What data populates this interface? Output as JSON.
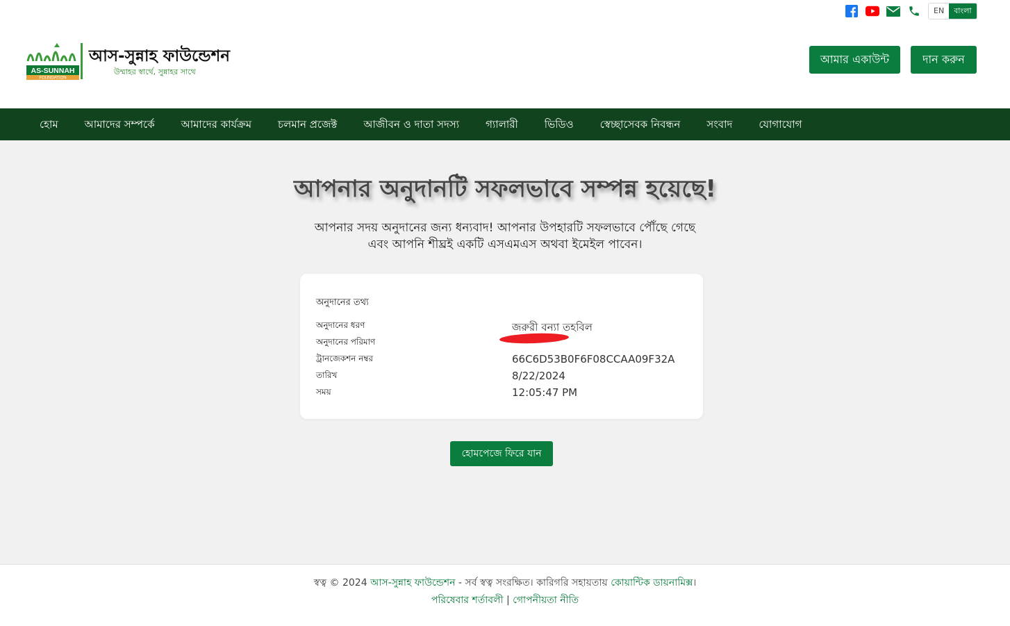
{
  "header": {
    "language": {
      "en": "EN",
      "bn": "বাংলা"
    },
    "brand_name": "আস-সুন্নাহ ফাউন্ডেশন",
    "brand_tagline": "উম্মাহর স্বার্থে, সুন্নাহর সাথে",
    "logo_text": "AS-SUNNAH",
    "logo_subtext": "FOUNDATION",
    "account_button": "আমার একাউন্ট",
    "donate_button": "দান করুন",
    "icons": [
      "facebook-icon",
      "youtube-icon",
      "mail-icon",
      "phone-icon"
    ],
    "colors": {
      "facebook": "#1877f2",
      "youtube": "#ff0000",
      "accent": "#0b7d3e"
    }
  },
  "nav": {
    "items": [
      {
        "label": "হোম"
      },
      {
        "label": "আমাদের সম্পর্কে"
      },
      {
        "label": "আমাদের কার্যক্রম"
      },
      {
        "label": "চলমান প্রজেক্ট"
      },
      {
        "label": "আজীবন ও দাতা সদস্য"
      },
      {
        "label": "গ্যালারী"
      },
      {
        "label": "ভিডিও"
      },
      {
        "label": "স্বেচ্ছাসেবক নিবন্ধন"
      },
      {
        "label": "সংবাদ"
      },
      {
        "label": "যোগাযোগ"
      }
    ],
    "background": "#11441e"
  },
  "main": {
    "title": "আপনার অনুদানটি সফলভাবে সম্পন্ন হয়েছে!",
    "message_line1": "আপনার সদয় অনুদানের জন্য ধন্যবাদ! আপনার উপহারটি সফলভাবে পৌঁছে গেছে",
    "message_line2": "এবং আপনি শীঘ্রই একটি এসএমএস অথবা ইমেইল পাবেন।",
    "card": {
      "heading": "অনুদানের তথ্য",
      "rows": [
        {
          "label": "অনুদানের ধরণ",
          "value": "জরুরী বন্যা তহবিল"
        },
        {
          "label": "অনুদানের পরিমাণ",
          "value": ""
        },
        {
          "label": "ট্রানজেকশন নম্বর",
          "value": "66C6D53B0F6F08CCAA09F32A"
        },
        {
          "label": "তারিখ",
          "value": "8/22/2024"
        },
        {
          "label": "সময়",
          "value": "12:05:47 PM"
        }
      ]
    },
    "home_button": "হোমপেজে ফিরে যান"
  },
  "footer": {
    "copyright_prefix": "স্বত্ব © 2024",
    "org_link": "আস-সুন্নাহ ফাউন্ডেশন",
    "rights_text": "- সর্ব স্বত্ব সংরক্ষিত। কারিগরি সহায়তায়",
    "tech_link": "কোয়ান্টিক ডায়নামিক্স",
    "end_char": "।",
    "terms_link": "পরিষেবার শর্তাবলী",
    "separator": "|",
    "privacy_link": "গোপনীয়তা নীতি"
  }
}
